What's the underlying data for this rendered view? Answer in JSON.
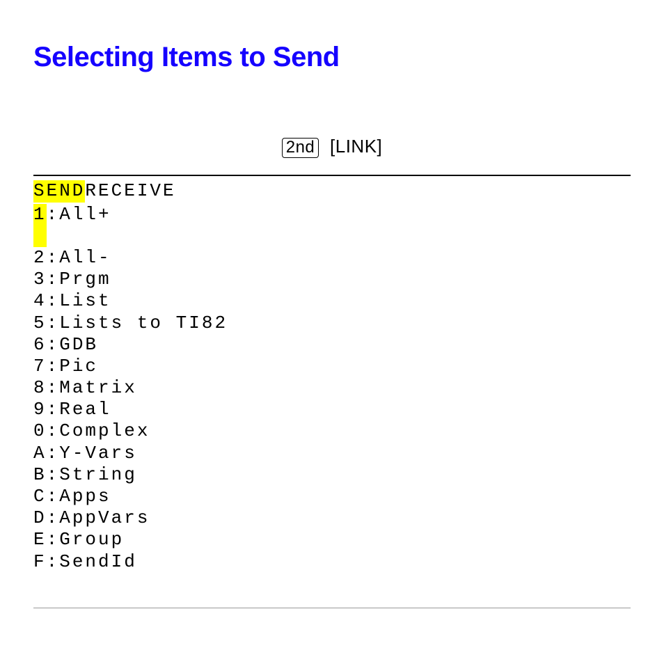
{
  "title": "Selecting Items to Send",
  "key": {
    "second": "2nd",
    "link": "LINK"
  },
  "tabs": {
    "send": "SEND",
    "receive": "RECEIVE"
  },
  "menu": {
    "items": [
      {
        "key": "1",
        "label": "All+",
        "selected": true
      },
      {
        "key": "2",
        "label": "All-",
        "selected": false
      },
      {
        "key": "3",
        "label": "Prgm",
        "selected": false
      },
      {
        "key": "4",
        "label": "List",
        "selected": false
      },
      {
        "key": "5",
        "label": "Lists to TI82",
        "selected": false
      },
      {
        "key": "6",
        "label": "GDB",
        "selected": false
      },
      {
        "key": "7",
        "label": "Pic",
        "selected": false
      },
      {
        "key": "8",
        "label": "Matrix",
        "selected": false
      },
      {
        "key": "9",
        "label": "Real",
        "selected": false
      },
      {
        "key": "0",
        "label": "Complex",
        "selected": false
      },
      {
        "key": "A",
        "label": "Y‑Vars",
        "selected": false
      },
      {
        "key": "B",
        "label": "String",
        "selected": false
      },
      {
        "key": "C",
        "label": "Apps",
        "selected": false
      },
      {
        "key": "D",
        "label": "AppVars",
        "selected": false
      },
      {
        "key": "E",
        "label": "Group",
        "selected": false
      },
      {
        "key": "F",
        "label": "SendId",
        "selected": false
      }
    ]
  }
}
